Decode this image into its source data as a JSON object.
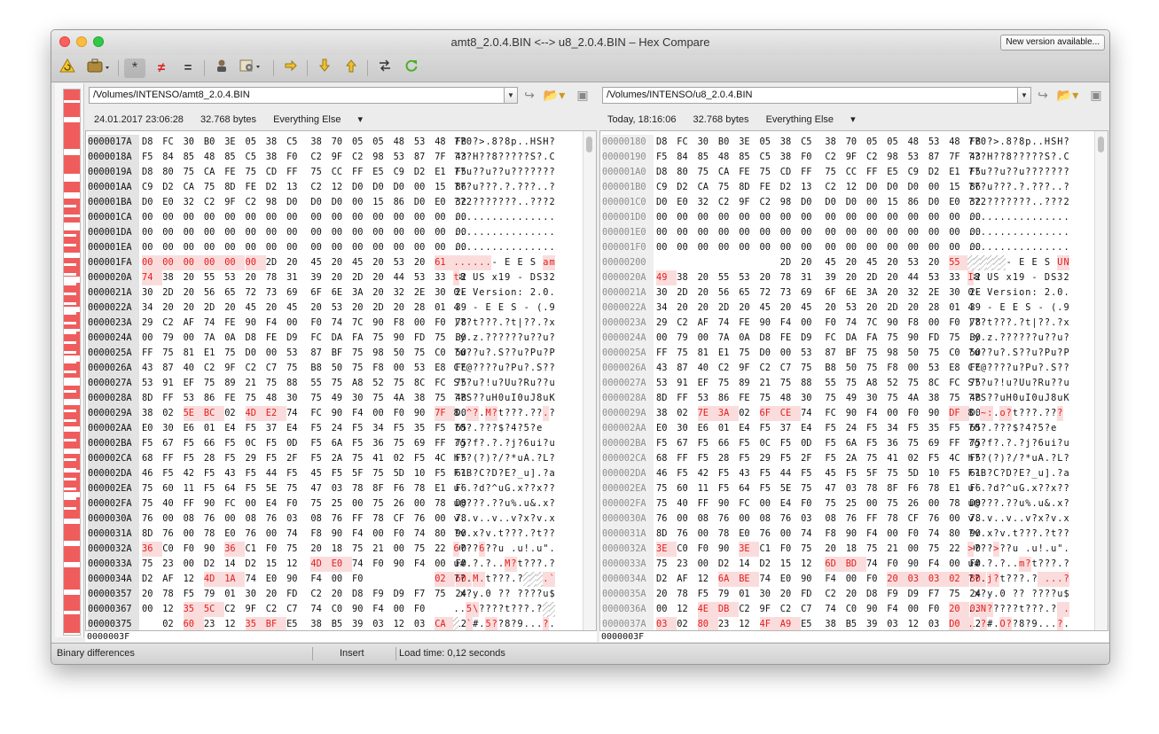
{
  "window": {
    "title": "amt8_2.0.4.BIN <--> u8_2.0.4.BIN – Hex Compare",
    "new_version_label": "New version available..."
  },
  "toolbar": {
    "icons": [
      "reload-icon",
      "briefcase-icon",
      "asterisk-icon",
      "not-equal-icon",
      "equal-icon",
      "user-icon",
      "settings-icon",
      "arrow-right-icon",
      "arrow-down-icon",
      "arrow-up-icon",
      "swap-icon",
      "refresh-icon"
    ],
    "glyphs": {
      "asterisk": "*",
      "not_equal": "≠",
      "equal": "="
    }
  },
  "colors": {
    "difference": "#e21d1d",
    "difference_bg": "#fbdcdc",
    "navigator_band": "#f05c5c",
    "reload_green": "#4caf2a",
    "arrow_yellow": "#e8b81a"
  },
  "left": {
    "path": "/Volumes/INTENSO/amt8_2.0.4.BIN",
    "date": "24.01.2017 23:06:28",
    "size": "32.768 bytes",
    "filter": "Everything Else",
    "offset": "0000003F",
    "rows": [
      {
        "addr": "0000017A",
        "hex": "D8 FC 30 B0 3E 05 38 C5 38 70 05 05 48 53 48 FB",
        "ascii": "??0?>.8?8p..HSH?",
        "diff": []
      },
      {
        "addr": "0000018A",
        "hex": "F5 84 85 48 85 C5 38 F0 C2 9F C2 98 53 87 7F 43",
        "ascii": "???H??8?????S?.C",
        "diff": []
      },
      {
        "addr": "0000019A",
        "hex": "D8 80 75 CA FE 75 CD FF 75 CC FF E5 C9 D2 E1 F5",
        "ascii": "??u??u??u???????",
        "diff": []
      },
      {
        "addr": "000001AA",
        "hex": "C9 D2 CA 75 8D FE D2 13 C2 12 D0 D0 D0 00 15 86",
        "ascii": "???u???.?.???..?",
        "diff": []
      },
      {
        "addr": "000001BA",
        "hex": "D0 E0 32 C2 9F C2 98 D0 D0 D0 00 15 86 D0 E0 32",
        "ascii": "??2???????..???2",
        "diff": []
      },
      {
        "addr": "000001CA",
        "hex": "00 00 00 00 00 00 00 00 00 00 00 00 00 00 00 00",
        "ascii": "................",
        "diff": []
      },
      {
        "addr": "000001DA",
        "hex": "00 00 00 00 00 00 00 00 00 00 00 00 00 00 00 00",
        "ascii": "................",
        "diff": []
      },
      {
        "addr": "000001EA",
        "hex": "00 00 00 00 00 00 00 00 00 00 00 00 00 00 00 00",
        "ascii": "................",
        "diff": []
      },
      {
        "addr": "000001FA",
        "hex": "00 00 00 00 00 00 2D 20 45 20 45 20 53 20 61 6D",
        "ascii": "......- E E S am",
        "diff": [
          0,
          1,
          2,
          3,
          4,
          5,
          14,
          15
        ]
      },
      {
        "addr": "0000020A",
        "hex": "74 38 20 55 53 20 78 31 39 20 2D 20 44 53 33 32",
        "ascii": "t8 US x19 - DS32",
        "diff": [
          0
        ]
      },
      {
        "addr": "0000021A",
        "hex": "30 2D 20 56 65 72 73 69 6F 6E 3A 20 32 2E 30 2E",
        "ascii": "0- Version: 2.0.",
        "diff": []
      },
      {
        "addr": "0000022A",
        "hex": "34 20 20 2D 20 45 20 45 20 53 20 2D 20 28 01 39",
        "ascii": "4  - E E S - (.9",
        "diff": []
      },
      {
        "addr": "0000023A",
        "hex": "29 C2 AF 74 FE 90 F4 00 F0 74 7C 90 F8 00 F0 78",
        "ascii": ")??t???.?t|??.?x",
        "diff": []
      },
      {
        "addr": "0000024A",
        "hex": "00 79 00 7A 0A D8 FE D9 FC DA FA 75 90 FD 75 B0",
        "ascii": ".y.z.??????u??u?",
        "diff": []
      },
      {
        "addr": "0000025A",
        "hex": "FF 75 81 E1 75 D0 00 53 87 BF 75 98 50 75 C0 50",
        "ascii": "?u??u?.S??u?Pu?P",
        "diff": []
      },
      {
        "addr": "0000026A",
        "hex": "43 87 40 C2 9F C2 C7 75 B8 50 75 F8 00 53 E8 FE",
        "ascii": "C?@????u?Pu?.S??",
        "diff": []
      },
      {
        "addr": "0000027A",
        "hex": "53 91 EF 75 89 21 75 88 55 75 A8 52 75 8C FC 75",
        "ascii": "S??u?!u?Uu?Ru??u",
        "diff": []
      },
      {
        "addr": "0000028A",
        "hex": "8D FF 53 86 FE 75 48 30 75 49 30 75 4A 38 75 4B",
        "ascii": "??S??uH0uI0uJ8uK",
        "diff": []
      },
      {
        "addr": "0000029A",
        "hex": "38 02 5E BC 02 4D E2 74 FC 90 F4 00 F0 90 7F D0",
        "ascii": "8.^?.M?t???.??.?",
        "diff": [
          2,
          3,
          5,
          6,
          14
        ]
      },
      {
        "addr": "000002AA",
        "hex": "E0 30 E6 01 E4 F5 37 E4 F5 24 F5 34 F5 35 F5 65",
        "ascii": "?0?.???$?4?5?e",
        "diff": []
      },
      {
        "addr": "000002BA",
        "hex": "F5 67 F5 66 F5 0C F5 0D F5 6A F5 36 75 69 FF 75",
        "ascii": "?g?f?.?.?j?6ui?u",
        "diff": []
      },
      {
        "addr": "000002CA",
        "hex": "68 FF F5 28 F5 29 F5 2F F5 2A 75 41 02 F5 4C F5",
        "ascii": "h??(?)?/?*uA.?L?",
        "diff": []
      },
      {
        "addr": "000002DA",
        "hex": "46 F5 42 F5 43 F5 44 F5 45 F5 5F 75 5D 10 F5 61",
        "ascii": "F?B?C?D?E?_u].?a",
        "diff": []
      },
      {
        "addr": "000002EA",
        "hex": "75 60 11 F5 64 F5 5E 75 47 03 78 8F F6 78 E1 F6",
        "ascii": "u`.?d?^uG.x??x??",
        "diff": []
      },
      {
        "addr": "000002FA",
        "hex": "75 40 FF 90 FC 00 E4 F0 75 25 00 75 26 00 78 D0",
        "ascii": "u@???.??u%.u&.x?",
        "diff": []
      },
      {
        "addr": "0000030A",
        "hex": "76 00 08 76 00 08 76 03 08 76 FF 78 CF 76 00 78",
        "ascii": "v..v..v..v?x?v.x",
        "diff": []
      },
      {
        "addr": "0000031A",
        "hex": "8D 76 00 78 E0 76 00 74 F8 90 F4 00 F0 74 80 90",
        "ascii": "?v.x?v.t???.?t??",
        "diff": []
      },
      {
        "addr": "0000032A",
        "hex": "36 C0 F0 90 36 C1 F0 75 20 18 75 21 00 75 22 00",
        "ascii": "6???6??u .u!.u\".",
        "diff": [
          0,
          4
        ]
      },
      {
        "addr": "0000033A",
        "hex": "75 23 00 D2 14 D2 15 12 4D E0 74 F0 90 F4 00 F0",
        "ascii": "u#.?.?..M?t???.?",
        "diff": [
          8,
          9
        ]
      },
      {
        "addr": "0000034A",
        "hex": "D2 AF 12 4D 1A 74 E0 90 F4 00 F0 -- -- -- 02 60",
        "ascii": "??.M.t???.?   .`",
        "diff": [
          3,
          4,
          14,
          15
        ],
        "gap": [
          11,
          12,
          13
        ]
      },
      {
        "addr": "00000357",
        "hex": "20 78 F5 79 01 30 20 FD C2 20 D8 F9 D9 F7 75 24",
        "ascii": " x?y.0 ?? ????u$",
        "diff": []
      },
      {
        "addr": "00000367",
        "hex": "00 12 35 5C C2 9F C2 C7 74 C0 90 F4 00 F0 -- --",
        "ascii": "..5\\????t???.?  ",
        "diff": [
          2,
          3
        ],
        "gap": [
          14,
          15
        ]
      },
      {
        "addr": "00000375",
        "hex": "-- 02 60 23 12 35 BF E5 38 B5 39 03 12 03 CA 12",
        "ascii": " .`#.5??8?9...?.",
        "diff": [
          2,
          5,
          6,
          14
        ],
        "gap": [
          0
        ]
      }
    ]
  },
  "right": {
    "path": "/Volumes/INTENSO/u8_2.0.4.BIN",
    "date": "Today, 18:16:06",
    "size": "32.768 bytes",
    "filter": "Everything Else",
    "offset": "0000003F",
    "rows": [
      {
        "addr": "00000180",
        "hex": "D8 FC 30 B0 3E 05 38 C5 38 70 05 05 48 53 48 FB",
        "ascii": "??0?>.8?8p..HSH?",
        "diff": []
      },
      {
        "addr": "00000190",
        "hex": "F5 84 85 48 85 C5 38 F0 C2 9F C2 98 53 87 7F 43",
        "ascii": "???H??8?????S?.C",
        "diff": []
      },
      {
        "addr": "000001A0",
        "hex": "D8 80 75 CA FE 75 CD FF 75 CC FF E5 C9 D2 E1 F5",
        "ascii": "??u??u??u???????",
        "diff": []
      },
      {
        "addr": "000001B0",
        "hex": "C9 D2 CA 75 8D FE D2 13 C2 12 D0 D0 D0 00 15 86",
        "ascii": "???u???.?.???..?",
        "diff": []
      },
      {
        "addr": "000001C0",
        "hex": "D0 E0 32 C2 9F C2 98 D0 D0 D0 00 15 86 D0 E0 32",
        "ascii": "??2???????..???2",
        "diff": []
      },
      {
        "addr": "000001D0",
        "hex": "00 00 00 00 00 00 00 00 00 00 00 00 00 00 00 00",
        "ascii": "................",
        "diff": []
      },
      {
        "addr": "000001E0",
        "hex": "00 00 00 00 00 00 00 00 00 00 00 00 00 00 00 00",
        "ascii": "................",
        "diff": []
      },
      {
        "addr": "000001F0",
        "hex": "00 00 00 00 00 00 00 00 00 00 00 00 00 00 00 00",
        "ascii": "................",
        "diff": []
      },
      {
        "addr": "00000200",
        "hex": "-- -- -- -- -- -- 2D 20 45 20 45 20 53 20 55 4E",
        "ascii": "      - E E S UN",
        "diff": [
          14,
          15
        ],
        "gap": [
          0,
          1,
          2,
          3,
          4,
          5
        ]
      },
      {
        "addr": "0000020A",
        "hex": "49 38 20 55 53 20 78 31 39 20 2D 20 44 53 33 32",
        "ascii": "I8 US x19 - DS32",
        "diff": [
          0
        ]
      },
      {
        "addr": "0000021A",
        "hex": "30 2D 20 56 65 72 73 69 6F 6E 3A 20 32 2E 30 2E",
        "ascii": "0- Version: 2.0.",
        "diff": []
      },
      {
        "addr": "0000022A",
        "hex": "34 20 20 2D 20 45 20 45 20 53 20 2D 20 28 01 39",
        "ascii": "4  - E E S - (.9",
        "diff": []
      },
      {
        "addr": "0000023A",
        "hex": "29 C2 AF 74 FE 90 F4 00 F0 74 7C 90 F8 00 F0 78",
        "ascii": ")??t???.?t|??.?x",
        "diff": []
      },
      {
        "addr": "0000024A",
        "hex": "00 79 00 7A 0A D8 FE D9 FC DA FA 75 90 FD 75 B0",
        "ascii": ".y.z.??????u??u?",
        "diff": []
      },
      {
        "addr": "0000025A",
        "hex": "FF 75 81 E1 75 D0 00 53 87 BF 75 98 50 75 C0 50",
        "ascii": "?u??u?.S??u?Pu?P",
        "diff": []
      },
      {
        "addr": "0000026A",
        "hex": "43 87 40 C2 9F C2 C7 75 B8 50 75 F8 00 53 E8 FE",
        "ascii": "C?@????u?Pu?.S??",
        "diff": []
      },
      {
        "addr": "0000027A",
        "hex": "53 91 EF 75 89 21 75 88 55 75 A8 52 75 8C FC 75",
        "ascii": "S??u?!u?Uu?Ru??u",
        "diff": []
      },
      {
        "addr": "0000028A",
        "hex": "8D FF 53 86 FE 75 48 30 75 49 30 75 4A 38 75 4B",
        "ascii": "??S??uH0uI0uJ8uK",
        "diff": []
      },
      {
        "addr": "0000029A",
        "hex": "38 02 7E 3A 02 6F CE 74 FC 90 F4 00 F0 90 DF D0",
        "ascii": "8.~:.o?t???.???",
        "diff": [
          2,
          3,
          5,
          6,
          14
        ]
      },
      {
        "addr": "000002AA",
        "hex": "E0 30 E6 01 E4 F5 37 E4 F5 24 F5 34 F5 35 F5 65",
        "ascii": "?0?.???$?4?5?e",
        "diff": []
      },
      {
        "addr": "000002BA",
        "hex": "F5 67 F5 66 F5 0C F5 0D F5 6A F5 36 75 69 FF 75",
        "ascii": "?g?f?.?.?j?6ui?u",
        "diff": []
      },
      {
        "addr": "000002CA",
        "hex": "68 FF F5 28 F5 29 F5 2F F5 2A 75 41 02 F5 4C F5",
        "ascii": "h??(?)?/?*uA.?L?",
        "diff": []
      },
      {
        "addr": "000002DA",
        "hex": "46 F5 42 F5 43 F5 44 F5 45 F5 5F 75 5D 10 F5 61",
        "ascii": "F?B?C?D?E?_u].?a",
        "diff": []
      },
      {
        "addr": "000002EA",
        "hex": "75 60 11 F5 64 F5 5E 75 47 03 78 8F F6 78 E1 F6",
        "ascii": "u`.?d?^uG.x??x??",
        "diff": []
      },
      {
        "addr": "000002FA",
        "hex": "75 40 FF 90 FC 00 E4 F0 75 25 00 75 26 00 78 D0",
        "ascii": "u@???.??u%.u&.x?",
        "diff": []
      },
      {
        "addr": "0000030A",
        "hex": "76 00 08 76 00 08 76 03 08 76 FF 78 CF 76 00 78",
        "ascii": "v..v..v..v?x?v.x",
        "diff": []
      },
      {
        "addr": "0000031A",
        "hex": "8D 76 00 78 E0 76 00 74 F8 90 F4 00 F0 74 80 90",
        "ascii": "?v.x?v.t???.?t??",
        "diff": []
      },
      {
        "addr": "0000032A",
        "hex": "3E C0 F0 90 3E C1 F0 75 20 18 75 21 00 75 22 00",
        "ascii": ">???>??u .u!.u\".",
        "diff": [
          0,
          4
        ]
      },
      {
        "addr": "0000033A",
        "hex": "75 23 00 D2 14 D2 15 12 6D BD 74 F0 90 F4 00 F0",
        "ascii": "u#.?.?..m?t???.?",
        "diff": [
          8,
          9
        ]
      },
      {
        "addr": "0000034A",
        "hex": "D2 AF 12 6A BE 74 E0 90 F4 00 F0 20 03 03 02 80",
        "ascii": "??.j?t???.? ...?",
        "diff": [
          3,
          4,
          11,
          12,
          13,
          14,
          15
        ]
      },
      {
        "addr": "0000035A",
        "hex": "20 78 F5 79 01 30 20 FD C2 20 D8 F9 D9 F7 75 24",
        "ascii": " x?y.0 ?? ????u$",
        "diff": []
      },
      {
        "addr": "0000036A",
        "hex": "00 12 4E DB C2 9F C2 C7 74 C0 90 F4 00 F0 20 03",
        "ascii": "..N?????t???.? .",
        "diff": [
          2,
          3,
          14,
          15
        ]
      },
      {
        "addr": "0000037A",
        "hex": "03 02 80 23 12 4F A9 E5 38 B5 39 03 12 03 D0 12",
        "ascii": "..?#.O??8?9...?.",
        "diff": [
          0,
          2,
          5,
          6,
          14
        ]
      }
    ]
  },
  "status": {
    "message": "Binary differences",
    "mode": "Insert",
    "load_time": "Load time: 0,12 seconds"
  },
  "navigator": {
    "bands": [
      [
        0.0,
        0.02
      ],
      [
        0.025,
        0.05
      ],
      [
        0.06,
        0.11
      ],
      [
        0.12,
        0.155
      ],
      [
        0.17,
        0.19
      ],
      [
        0.2,
        0.23
      ],
      [
        0.235,
        0.245
      ],
      [
        0.26,
        0.3
      ],
      [
        0.31,
        0.345
      ],
      [
        0.355,
        0.4
      ],
      [
        0.41,
        0.44
      ],
      [
        0.445,
        0.49
      ],
      [
        0.5,
        0.53
      ],
      [
        0.545,
        0.57
      ],
      [
        0.58,
        0.62
      ],
      [
        0.63,
        0.66
      ],
      [
        0.67,
        0.7
      ],
      [
        0.705,
        0.74
      ],
      [
        0.75,
        0.79
      ],
      [
        0.8,
        0.83
      ],
      [
        0.84,
        0.87
      ],
      [
        0.88,
        0.92
      ],
      [
        0.93,
        0.96
      ],
      [
        0.965,
        1.0
      ]
    ]
  }
}
